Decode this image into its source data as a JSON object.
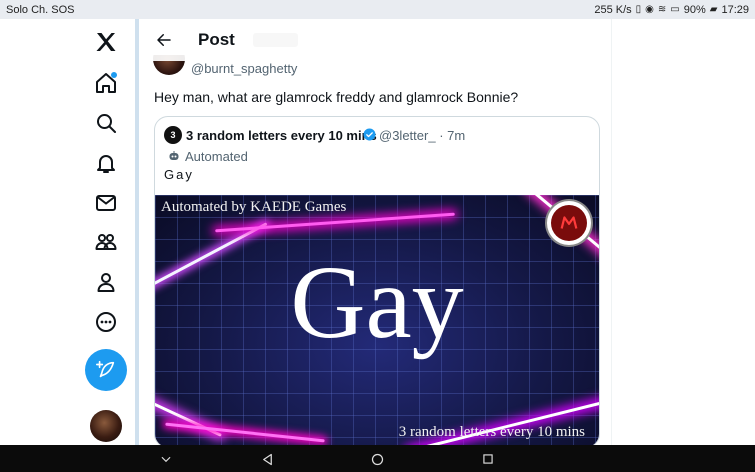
{
  "status_bar": {
    "carrier": "Solo Ch. SOS",
    "speed": "255 K/s",
    "battery": "90%",
    "time": "17:29"
  },
  "nav": {
    "items": [
      "x-logo",
      "home",
      "explore",
      "notifications",
      "messages",
      "communities",
      "profile",
      "more"
    ],
    "accent_color": "#1d9bf0"
  },
  "header": {
    "title": "Post"
  },
  "post": {
    "handle": "@burnt_spaghetty",
    "text": "Hey man, what are glamrock freddy and glamrock Bonnie?"
  },
  "quote": {
    "avatar_text": "3",
    "name": "3 random letters every 10 mins",
    "handle": "@3letter_",
    "time": "· 7m",
    "automated_label": "Automated",
    "text": "Gay",
    "media": {
      "top_caption": "Automated by KAEDE Games",
      "big_word": "Gay",
      "bottom_caption": "3 random letters every 10 mins"
    }
  }
}
